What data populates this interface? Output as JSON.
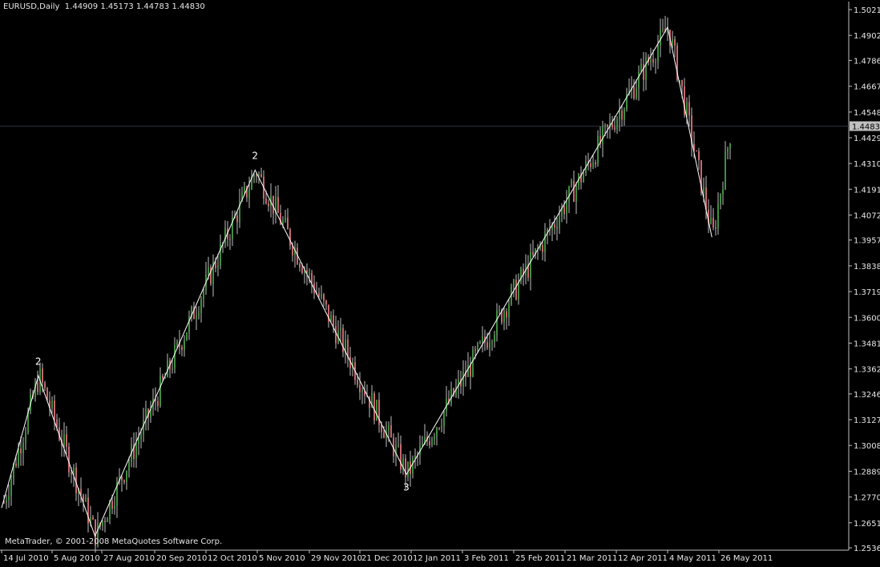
{
  "header": {
    "symbol": "EURUSD,Daily",
    "open": "1.44909",
    "high": "1.45173",
    "low": "1.44783",
    "close": "1.44830"
  },
  "copyright": "MetaTrader, © 2001-2008 MetaQuotes Software Corp.",
  "current_price_label": "1.44830",
  "colors": {
    "background": "#000000",
    "axis": "#c0c0c0",
    "bull_candle": "#3f8f3f",
    "bear_candle": "#c8686f",
    "wick": "#bfbfbf",
    "zigzag": "#ffffff",
    "price_line": "#2a2e40",
    "label_box": "#c0c0c0"
  },
  "chart_data": {
    "type": "candlestick",
    "y_ticks": [
      "1.50210",
      "1.49020",
      "1.47865",
      "1.46670",
      "1.45480",
      "1.44295",
      "1.43105",
      "1.41915",
      "1.40725",
      "1.39570",
      "1.38380",
      "1.37190",
      "1.36000",
      "1.34810",
      "1.33620",
      "1.32465",
      "1.31275",
      "1.30085",
      "1.28895",
      "1.27705",
      "1.26515",
      "1.25360"
    ],
    "ylim": [
      1.2536,
      1.5021
    ],
    "x_ticks": [
      "14 Jul 2010",
      "5 Aug 2010",
      "27 Aug 2010",
      "20 Sep 2010",
      "12 Oct 2010",
      "5 Nov 2010",
      "29 Nov 2010",
      "21 Dec 2010",
      "12 Jan 2011",
      "3 Feb 2011",
      "25 Feb 2011",
      "21 Mar 2011",
      "12 Apr 2011",
      "4 May 2011",
      "26 May 2011"
    ],
    "zigzag_points": [
      {
        "date": "14 Jul 2010",
        "price": 1.272
      },
      {
        "date": "30 Jul 2010",
        "price": 1.333
      },
      {
        "date": "24 Aug 2010",
        "price": 1.259
      },
      {
        "date": "4 Nov 2010",
        "price": 1.428
      },
      {
        "date": "10 Jan 2011",
        "price": 1.2875
      },
      {
        "date": "4 May 2011",
        "price": 1.494
      },
      {
        "date": "23 May 2011",
        "price": 1.397
      }
    ],
    "wave_labels": [
      {
        "text": "2",
        "date": "30 Jul 2010",
        "price": 1.333,
        "position": "above"
      },
      {
        "text": "2",
        "date": "4 Nov 2010",
        "price": 1.428,
        "position": "above"
      },
      {
        "text": "3",
        "date": "10 Jan 2011",
        "price": 1.2875,
        "position": "below"
      }
    ],
    "current_price": 1.4483,
    "grid": false
  }
}
